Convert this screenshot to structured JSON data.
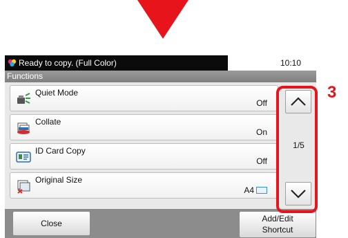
{
  "indicator": {
    "arrow_color": "#e8141c",
    "callout_number": "3"
  },
  "statusbar": {
    "message": "Ready to copy. (Full Color)",
    "status_icon": "color-copy-icon",
    "time": "10:10"
  },
  "titlebar": {
    "title": "Functions"
  },
  "functions": [
    {
      "name": "Quiet Mode",
      "value": "Off",
      "icon": "quiet-mode-icon"
    },
    {
      "name": "Collate",
      "value": "On",
      "icon": "collate-icon"
    },
    {
      "name": "ID Card Copy",
      "value": "Off",
      "icon": "id-card-icon"
    },
    {
      "name": "Original Size",
      "value": "A4",
      "icon": "original-size-icon"
    }
  ],
  "pagination": {
    "label": "1/5"
  },
  "buttons": {
    "close_label": "Close",
    "shortcut_line1": "Add/Edit",
    "shortcut_line2": "Shortcut"
  }
}
